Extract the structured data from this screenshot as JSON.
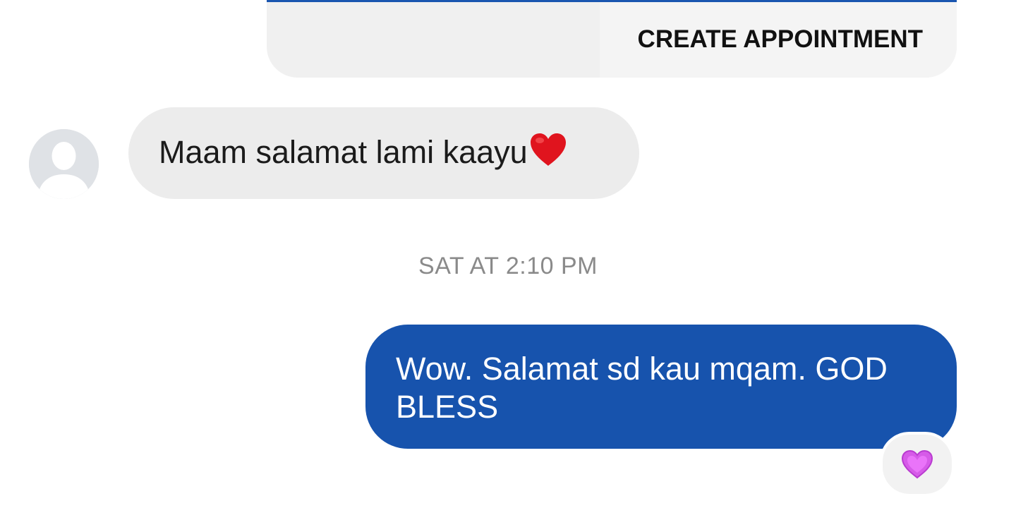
{
  "appointment_card": {
    "button_label": "CREATE APPOINTMENT"
  },
  "conversation": {
    "incoming_message": {
      "text": "Maam salamat lami kaayu",
      "emoji": "red-heart-icon"
    },
    "timestamp": "SAT AT 2:10 PM",
    "outgoing_message": {
      "text": "Wow. Salamat sd kau mqam. GOD BLESS",
      "reaction": "purple-heart-icon"
    }
  },
  "colors": {
    "outgoing_bubble": "#1753ad",
    "incoming_bubble": "#ececec",
    "accent_line": "#1a56b0",
    "reaction_heart": "#d65be8"
  }
}
